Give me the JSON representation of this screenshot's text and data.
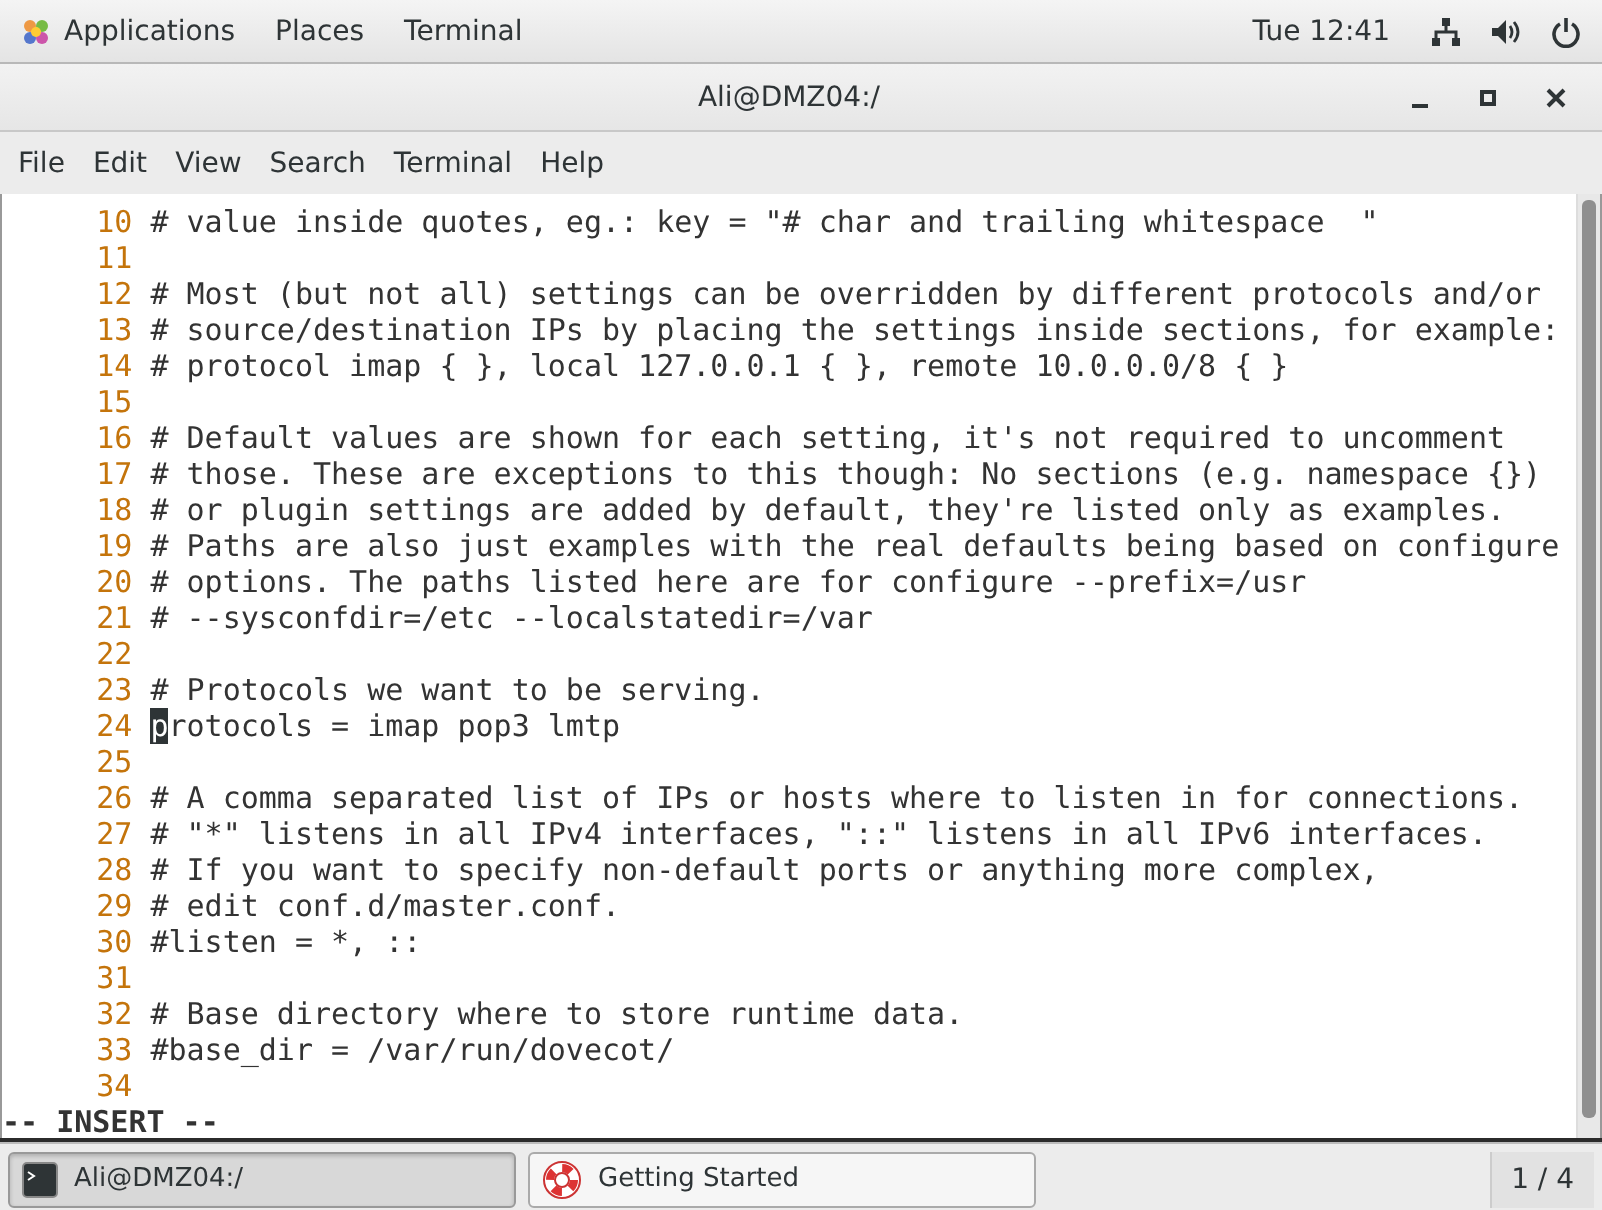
{
  "top_bar": {
    "menus": [
      "Applications",
      "Places",
      "Terminal"
    ],
    "clock": "Tue 12:41"
  },
  "window": {
    "title": "Ali@DMZ04:/"
  },
  "menu_bar": [
    "File",
    "Edit",
    "View",
    "Search",
    "Terminal",
    "Help"
  ],
  "editor": {
    "lines": [
      {
        "number": "10",
        "text": "# value inside quotes, eg.: key = \"# char and trailing whitespace  \"",
        "cursor": false
      },
      {
        "number": "11",
        "cursor": false
      },
      {
        "number": "12",
        "text": "# Most (but not all) settings can be overridden by different protocols and/or",
        "cursor": false
      },
      {
        "number": "13",
        "text": "# source/destination IPs by placing the settings inside sections, for example:",
        "cursor": false
      },
      {
        "number": "14",
        "text": "# protocol imap { }, local 127.0.0.1 { }, remote 10.0.0.0/8 { }",
        "cursor": false
      },
      {
        "number": "15",
        "cursor": false
      },
      {
        "number": "16",
        "text": "# Default values are shown for each setting, it's not required to uncomment",
        "cursor": false
      },
      {
        "number": "17",
        "text": "# those. These are exceptions to this though: No sections (e.g. namespace {})",
        "cursor": false
      },
      {
        "number": "18",
        "text": "# or plugin settings are added by default, they're listed only as examples.",
        "cursor": false
      },
      {
        "number": "19",
        "text": "# Paths are also just examples with the real defaults being based on configure",
        "cursor": false
      },
      {
        "number": "20",
        "text": "# options. The paths listed here are for configure --prefix=/usr",
        "cursor": false
      },
      {
        "number": "21",
        "text": "# --sysconfdir=/etc --localstatedir=/var",
        "cursor": false
      },
      {
        "number": "22",
        "cursor": false
      },
      {
        "number": "23",
        "text": "# Protocols we want to be serving.",
        "cursor": false
      },
      {
        "number": "24",
        "text": "protocols = imap pop3 lmtp",
        "cursor": true
      },
      {
        "number": "25",
        "cursor": false
      },
      {
        "number": "26",
        "text": "# A comma separated list of IPs or hosts where to listen in for connections.",
        "cursor": false
      },
      {
        "number": "27",
        "text": "# \"*\" listens in all IPv4 interfaces, \"::\" listens in all IPv6 interfaces.",
        "cursor": false
      },
      {
        "number": "28",
        "text": "# If you want to specify non-default ports or anything more complex,",
        "cursor": false
      },
      {
        "number": "29",
        "text": "# edit conf.d/master.conf.",
        "cursor": false
      },
      {
        "number": "30",
        "text": "#listen = *, ::",
        "cursor": false
      },
      {
        "number": "31",
        "cursor": false
      },
      {
        "number": "32",
        "text": "# Base directory where to store runtime data.",
        "cursor": false
      },
      {
        "number": "33",
        "text": "#base_dir = /var/run/dovecot/",
        "cursor": false
      },
      {
        "number": "34",
        "cursor": false
      }
    ],
    "mode": "-- INSERT --"
  },
  "taskbar": {
    "windows": [
      {
        "kind": "terminal",
        "label": "Ali@DMZ04:/",
        "selected": true
      },
      {
        "kind": "help",
        "label": "Getting Started",
        "selected": false
      }
    ],
    "workspace": "1 / 4"
  }
}
